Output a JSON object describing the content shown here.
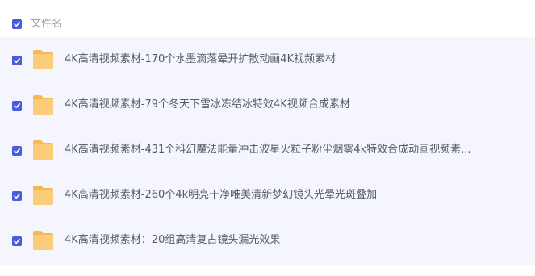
{
  "header": {
    "column_label": "文件名",
    "select_all_checked": true
  },
  "files": [
    {
      "name": "4K高清视频素材-170个水墨滴落晕开扩散动画4K视频素材",
      "checked": true,
      "icon": "folder-icon"
    },
    {
      "name": "4K高清视频素材-79个冬天下雪冰冻结冰特效4K视频合成素材",
      "checked": true,
      "icon": "folder-icon"
    },
    {
      "name": "4K高清视频素材-431个科幻魔法能量冲击波星火粒子粉尘烟雾4k特效合成动画视频素...",
      "checked": true,
      "icon": "folder-icon"
    },
    {
      "name": "4K高清视频素材-260个4k明亮干净唯美清新梦幻镜头光晕光斑叠加",
      "checked": true,
      "icon": "folder-icon"
    },
    {
      "name": "4K高清视频素材：20组高清复古镜头漏光效果",
      "checked": true,
      "icon": "folder-icon"
    }
  ],
  "colors": {
    "checkbox": "#4a5bdc",
    "folder": "#fbcd78",
    "list_background": "#f5f6fd"
  }
}
